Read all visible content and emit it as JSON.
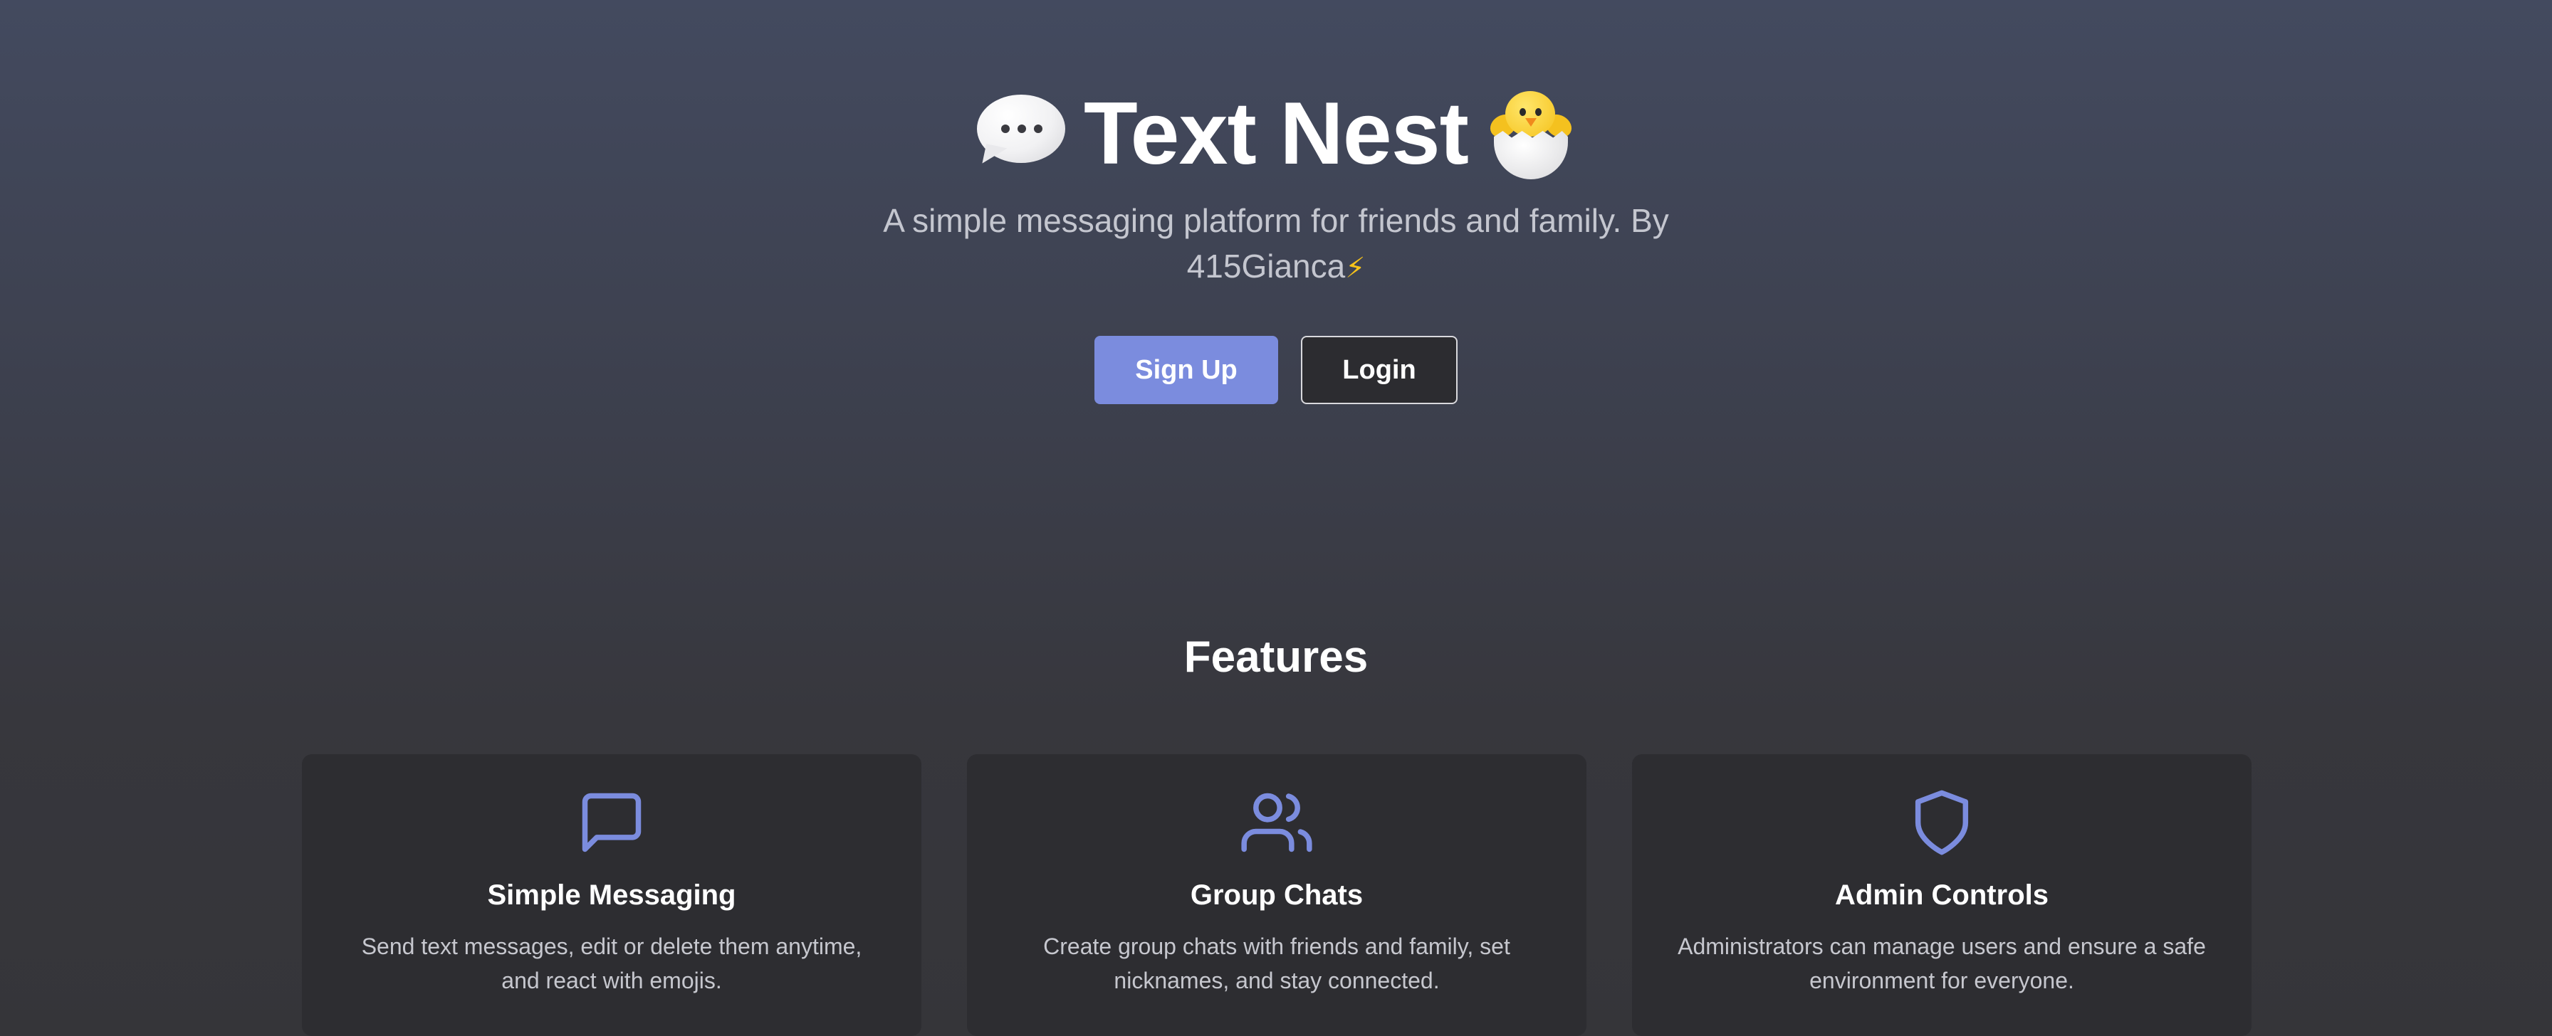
{
  "hero": {
    "title": "Text Nest",
    "subtitle": "A simple messaging platform for friends and family. By 415Gianca",
    "subtitle_emoji": "⚡",
    "title_left_icon": "speech-bubble-icon",
    "title_right_icon": "hatching-chick-icon"
  },
  "actions": {
    "signup_label": "Sign Up",
    "login_label": "Login"
  },
  "features": {
    "heading": "Features",
    "cards": [
      {
        "icon": "message-square-icon",
        "title": "Simple Messaging",
        "description": "Send text messages, edit or delete them anytime, and react with emojis."
      },
      {
        "icon": "users-icon",
        "title": "Group Chats",
        "description": "Create group chats with friends and family, set nicknames, and stay connected."
      },
      {
        "icon": "shield-icon",
        "title": "Admin Controls",
        "description": "Administrators can manage users and ensure a safe environment for everyone."
      }
    ]
  },
  "colors": {
    "accent": "#7b8cde",
    "card_bg": "#2d2d31",
    "login_bg": "#2c2c30"
  }
}
